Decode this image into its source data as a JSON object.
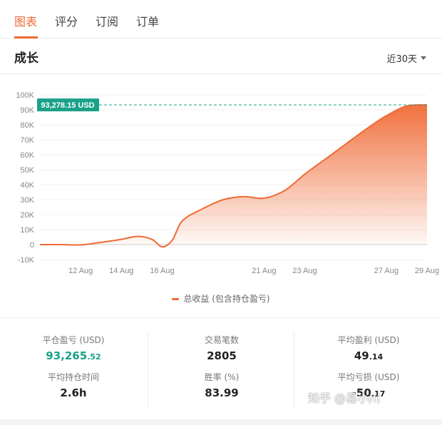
{
  "tabs": [
    {
      "label": "图表",
      "active": true
    },
    {
      "label": "评分",
      "active": false
    },
    {
      "label": "订阅",
      "active": false
    },
    {
      "label": "订单",
      "active": false
    }
  ],
  "section": {
    "title": "成长",
    "range_label": "近30天"
  },
  "colors": {
    "accent": "#f06a35",
    "positive": "#1aa189",
    "highlight_bg": "#1aa189"
  },
  "chart_data": {
    "type": "area",
    "series": [
      {
        "name": "总收益 (包含持仓盈亏)",
        "points": [
          [
            "10 Aug",
            0
          ],
          [
            "11 Aug",
            0
          ],
          [
            "12 Aug",
            -200
          ],
          [
            "13 Aug",
            1500
          ],
          [
            "14 Aug",
            3500
          ],
          [
            "14.8 Aug",
            5500
          ],
          [
            "15.5 Aug",
            3500
          ],
          [
            "16 Aug",
            -1500
          ],
          [
            "16.5 Aug",
            3000
          ],
          [
            "17 Aug",
            16000
          ],
          [
            "18 Aug",
            24000
          ],
          [
            "19 Aug",
            30000
          ],
          [
            "20 Aug",
            32000
          ],
          [
            "21 Aug",
            31000
          ],
          [
            "22 Aug",
            36000
          ],
          [
            "23 Aug",
            47000
          ],
          [
            "24 Aug",
            57000
          ],
          [
            "25 Aug",
            67000
          ],
          [
            "26 Aug",
            77000
          ],
          [
            "27 Aug",
            86000
          ],
          [
            "28 Aug",
            92500
          ],
          [
            "29 Aug",
            93278
          ]
        ]
      }
    ],
    "y_ticks": [
      "100K",
      "90K",
      "80K",
      "70K",
      "60K",
      "50K",
      "40K",
      "30K",
      "20K",
      "10K",
      "0",
      "-10K"
    ],
    "x_ticks": [
      "12 Aug",
      "14 Aug",
      "16 Aug",
      "21 Aug",
      "23 Aug",
      "27 Aug",
      "29 Aug"
    ],
    "ylim": [
      -10000,
      100000
    ],
    "grid": true,
    "reference_line": {
      "value": 93278.15,
      "label": "93,278.15 USD"
    },
    "legend_position": "bottom"
  },
  "stats": {
    "avg_pl_label": "平仓盈亏 (USD)",
    "avg_pl_int": "93,265",
    "avg_pl_dec": ".52",
    "trades_label": "交易笔数",
    "trades_value": "2805",
    "avg_profit_label": "平均盈利 (USD)",
    "avg_profit_int": "49",
    "avg_profit_dec": ".14",
    "hold_time_label": "平均持仓时间",
    "hold_time_value": "2.6h",
    "win_rate_label": "胜率 (%)",
    "win_rate_value": "83.99",
    "avg_loss_label": "平均亏损 (USD)",
    "avg_loss_int": "-50",
    "avg_loss_dec": ".17"
  },
  "watermark": "知乎 @易小川"
}
